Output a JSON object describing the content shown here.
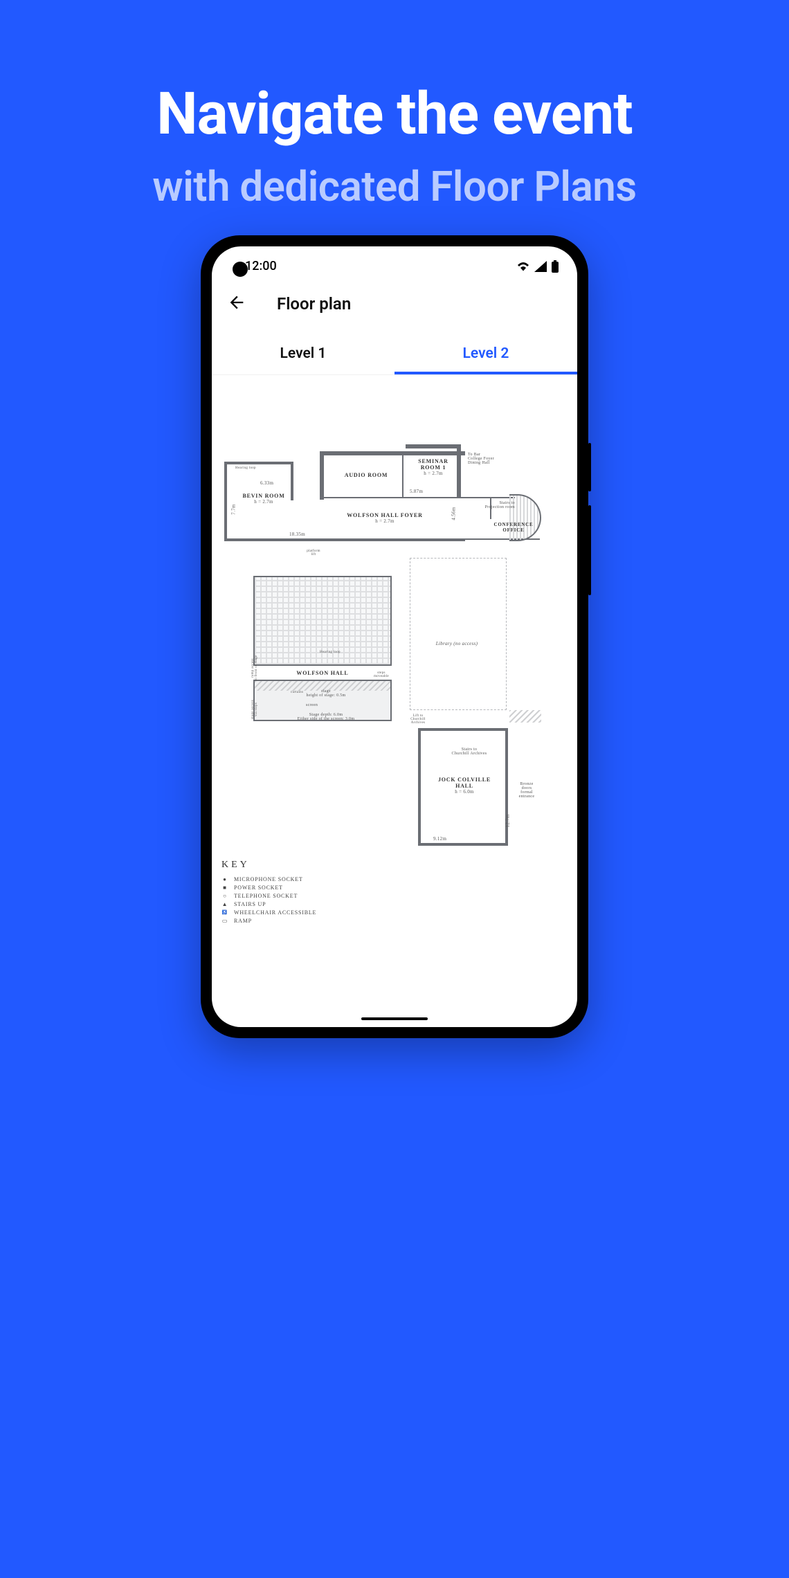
{
  "hero": {
    "title": "Navigate the event",
    "subtitle": "with dedicated Floor Plans"
  },
  "statusbar": {
    "time": "12:00"
  },
  "appbar": {
    "title": "Floor plan"
  },
  "tabs": [
    {
      "label": "Level 1",
      "active": false
    },
    {
      "label": "Level 2",
      "active": true
    }
  ],
  "plan": {
    "rooms": {
      "bevin": {
        "name": "BEVIN ROOM",
        "h": "h = 2.7m",
        "w1": "6.33m",
        "w2": "7.7m"
      },
      "audio": {
        "name": "AUDIO ROOM",
        "w": "5.87m"
      },
      "seminar": {
        "name": "SEMINAR ROOM 1",
        "h": "h = 2.7m"
      },
      "foyer": {
        "name": "WOLFSON HALL FOYER",
        "h": "h = 2.7m",
        "span": "18.35m",
        "height_dim": "4.56m"
      },
      "wolfson": {
        "name": "WOLFSON HALL"
      },
      "library": {
        "name": "Library (no access)"
      },
      "jock": {
        "name": "JOCK COLVILLE HALL",
        "h": "h = 6.0m",
        "w": "9.12m",
        "depth": "12.7m"
      },
      "conf": {
        "name": "CONFERENCE OFFICE"
      }
    },
    "annotations": {
      "to_bar": "To Bar\nCollege Foyer\nDining Hall",
      "stairs_proj": "Stairs to\nProjection room",
      "stairs_arch": "Stairs to\nChurchill Archives",
      "lift_arch": "Lift to\nChurchill\nArchives",
      "bronze": "Bronze\ndoors\nformal\nentrance",
      "hearing_loop": "Hearing loop",
      "platform_lift": "platform\nlift",
      "steps_moveable": "steps\nmoveable",
      "curtains": "curtains",
      "stage_block": "stage\nheight of stage: 0.5m",
      "screen": "screen",
      "stage_depth": "Stage depth: 6.0m\nEither side of the screen: 3.0m",
      "ramp_access": "ramp access\nto front of stage",
      "stage_access": "stage access\nvia steps"
    },
    "key": {
      "title": "KEY",
      "items": [
        {
          "sym": "●",
          "label": "MICROPHONE SOCKET"
        },
        {
          "sym": "■",
          "label": "POWER SOCKET"
        },
        {
          "sym": "○",
          "label": "TELEPHONE SOCKET"
        },
        {
          "sym": "▲",
          "label": "STAIRS UP"
        },
        {
          "sym": "wc",
          "label": "WHEELCHAIR ACCESSIBLE"
        },
        {
          "sym": "▭",
          "label": "RAMP"
        }
      ]
    }
  }
}
